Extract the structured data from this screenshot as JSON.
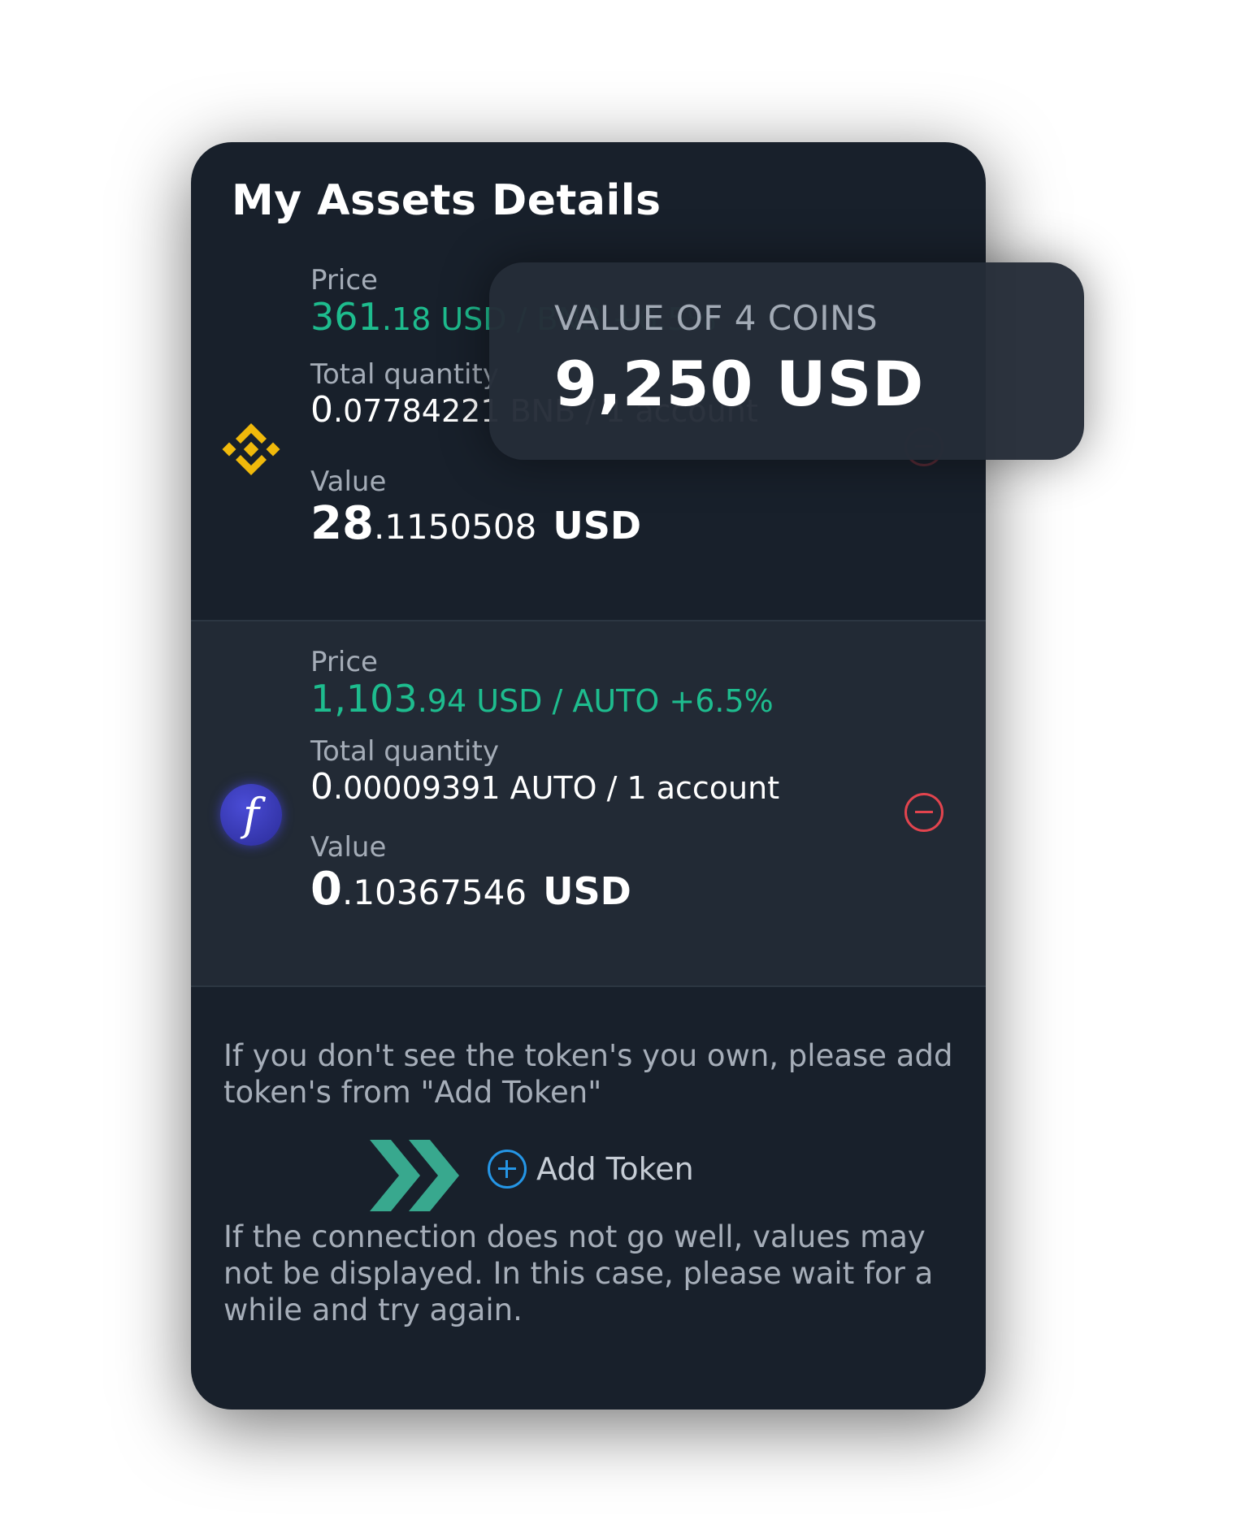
{
  "title": "My Assets Details",
  "coins": [
    {
      "name": "BNB",
      "price_label": "Price",
      "price_int": "361",
      "price_dec": ".18 USD / BNB +6.5%",
      "qty_label": "Total quantity",
      "qty_int": "0",
      "qty_dec": ".07784221 BNB / 1 account",
      "value_label": "Value",
      "value_int": "28",
      "value_dec": ".1150508",
      "value_unit": "USD"
    },
    {
      "name": "AUTO",
      "icon_glyph": "f",
      "price_label": "Price",
      "price_int": "1,103",
      "price_dec": ".94 USD / AUTO +6.5%",
      "qty_label": "Total quantity",
      "qty_int": "0",
      "qty_dec": ".00009391 AUTO / 1 account",
      "value_label": "Value",
      "value_int": "0",
      "value_dec": ".10367546",
      "value_unit": "USD"
    }
  ],
  "info_text_1": "If you don't see the token's you own, please add token's from \"Add Token\"",
  "add_token_label": "Add Token",
  "info_text_2": "If the connection does not go well, values may not be displayed. In this case, please wait for a while and try again.",
  "summary": {
    "label": "VALUE OF 4 COINS",
    "value": "9,250 USD"
  },
  "colors": {
    "card_bg": "#18202b",
    "row_alt_bg": "#222a35",
    "price_green": "#1ebc8e",
    "remove_red": "#e2444e",
    "add_blue": "#2596e6",
    "bnb_yellow": "#f0b90b",
    "chevron_teal": "#38a88e"
  },
  "icons": [
    "bnb-logo-icon",
    "auto-logo-icon",
    "remove-icon",
    "add-circle-icon",
    "double-chevron-icon"
  ]
}
